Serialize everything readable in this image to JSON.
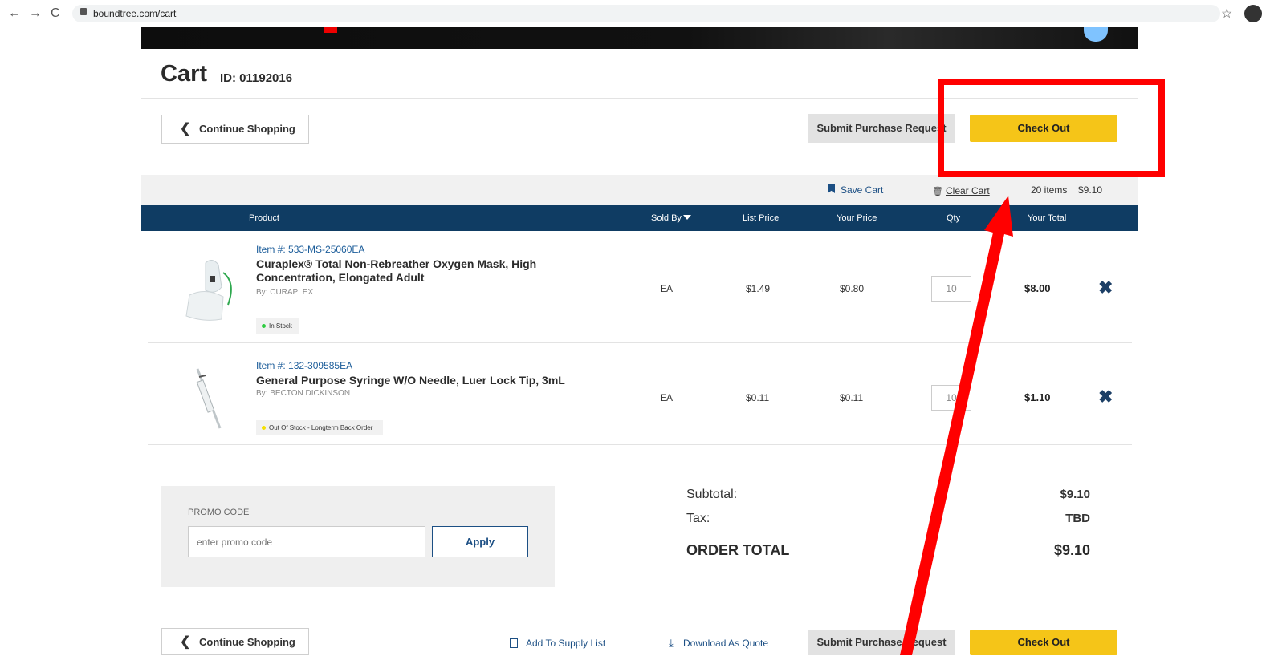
{
  "browser": {
    "back": "←",
    "forward": "→",
    "reload": "C",
    "url": "boundtree.com/cart",
    "star": "☆"
  },
  "cart": {
    "title": "Cart",
    "id_label": "ID: 01192016"
  },
  "actions": {
    "continue_shopping": "Continue Shopping",
    "chevron": "❮",
    "submit_purchase_request": "Submit Purchase Request",
    "check_out": "Check Out"
  },
  "utility": {
    "save_cart": "Save Cart",
    "clear_cart": "Clear Cart",
    "clear_icon": "🗑",
    "item_count": "20 items",
    "cart_total": "$9.10"
  },
  "table": {
    "headers": {
      "product": "Product",
      "sold_by": "Sold By",
      "list_price": "List Price",
      "your_price": "Your Price",
      "qty": "Qty",
      "your_total": "Your Total"
    },
    "rows": [
      {
        "item_number": "Item #: 533-MS-25060EA",
        "name": "Curaplex® Total Non-Rebreather Oxygen Mask, High Concentration, Elongated Adult",
        "by": "By: CURAPLEX",
        "stock": "In Stock",
        "stock_color": "#2ecc40",
        "sold_by": "EA",
        "list_price": "$1.49",
        "your_price": "$0.80",
        "qty": "10",
        "total": "$8.00",
        "remove_icon": "✖"
      },
      {
        "item_number": "Item #: 132-309585EA",
        "name": "General Purpose Syringe W/O Needle, Luer Lock Tip, 3mL",
        "by": "By: BECTON DICKINSON",
        "stock": "Out Of Stock - Longterm Back Order",
        "stock_color": "#f5e000",
        "sold_by": "EA",
        "list_price": "$0.11",
        "your_price": "$0.11",
        "qty": "10",
        "total": "$1.10",
        "remove_icon": "✖"
      }
    ]
  },
  "promo": {
    "label": "PROMO CODE",
    "placeholder": "enter promo code",
    "apply": "Apply"
  },
  "summary": {
    "subtotal_label": "Subtotal:",
    "subtotal_value": "$9.10",
    "tax_label": "Tax:",
    "tax_value": "TBD",
    "order_total_label": "ORDER TOTAL",
    "order_total_value": "$9.10"
  },
  "bottom": {
    "add_to_supply_list": "Add To Supply List",
    "download_as_quote": "Download As Quote",
    "download_icon": "⤓"
  },
  "colors": {
    "accent_yellow": "#f5c518",
    "header_navy": "#0f3c63",
    "link_blue": "#1c5d9a",
    "annotation_red": "#ff0000"
  }
}
